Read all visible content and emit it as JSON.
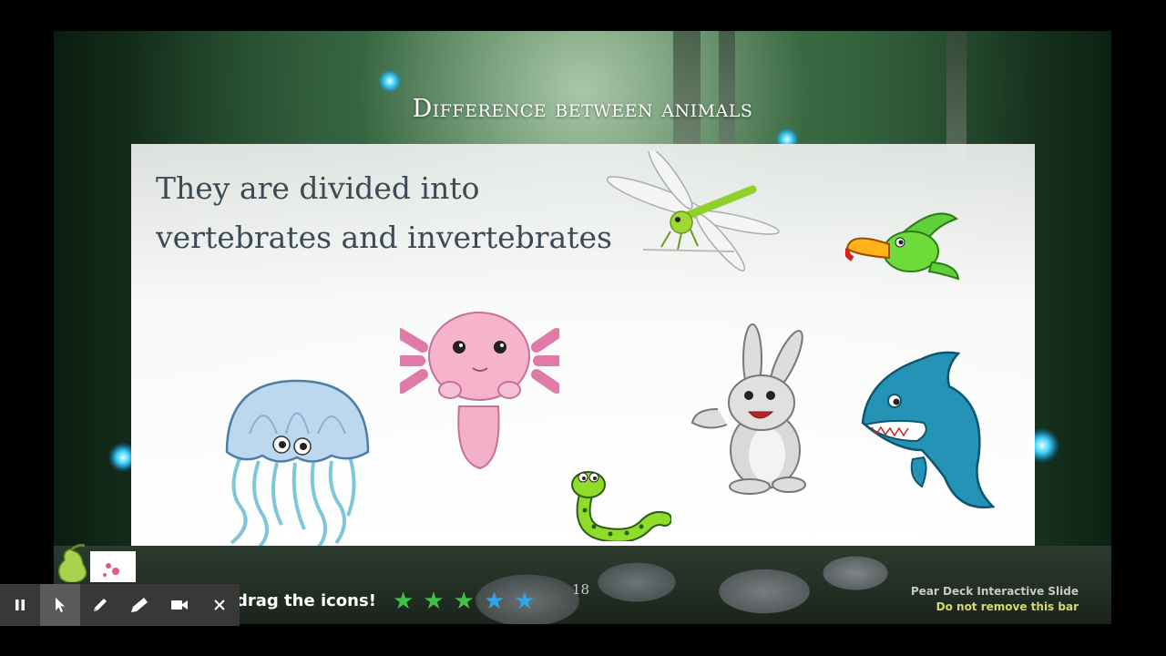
{
  "slide": {
    "title": "Difference between animals",
    "body_line1": "They are divided into",
    "body_line2": "vertebrates and invertebrates",
    "page_number": "18",
    "instruction": "drag the icons!"
  },
  "pear_deck": {
    "bar_title": "Pear Deck Interactive Slide",
    "bar_subtitle": "Do not remove this bar"
  },
  "stars": [
    {
      "color": "#3ec24a"
    },
    {
      "color": "#3ec24a"
    },
    {
      "color": "#3ec24a"
    },
    {
      "color": "#2fa4e8"
    },
    {
      "color": "#2fa4e8"
    }
  ],
  "toolbar": {
    "buttons": [
      {
        "icon": "pause-icon",
        "active": false
      },
      {
        "icon": "pointer-icon",
        "active": true
      },
      {
        "icon": "pen-icon",
        "active": false
      },
      {
        "icon": "highlighter-icon",
        "active": false
      },
      {
        "icon": "video-camera-icon",
        "active": false
      },
      {
        "icon": "close-icon",
        "active": false
      }
    ]
  },
  "animals": [
    "dragonfly",
    "parrot",
    "axolotl",
    "jellyfish",
    "snake",
    "rabbit",
    "shark"
  ]
}
